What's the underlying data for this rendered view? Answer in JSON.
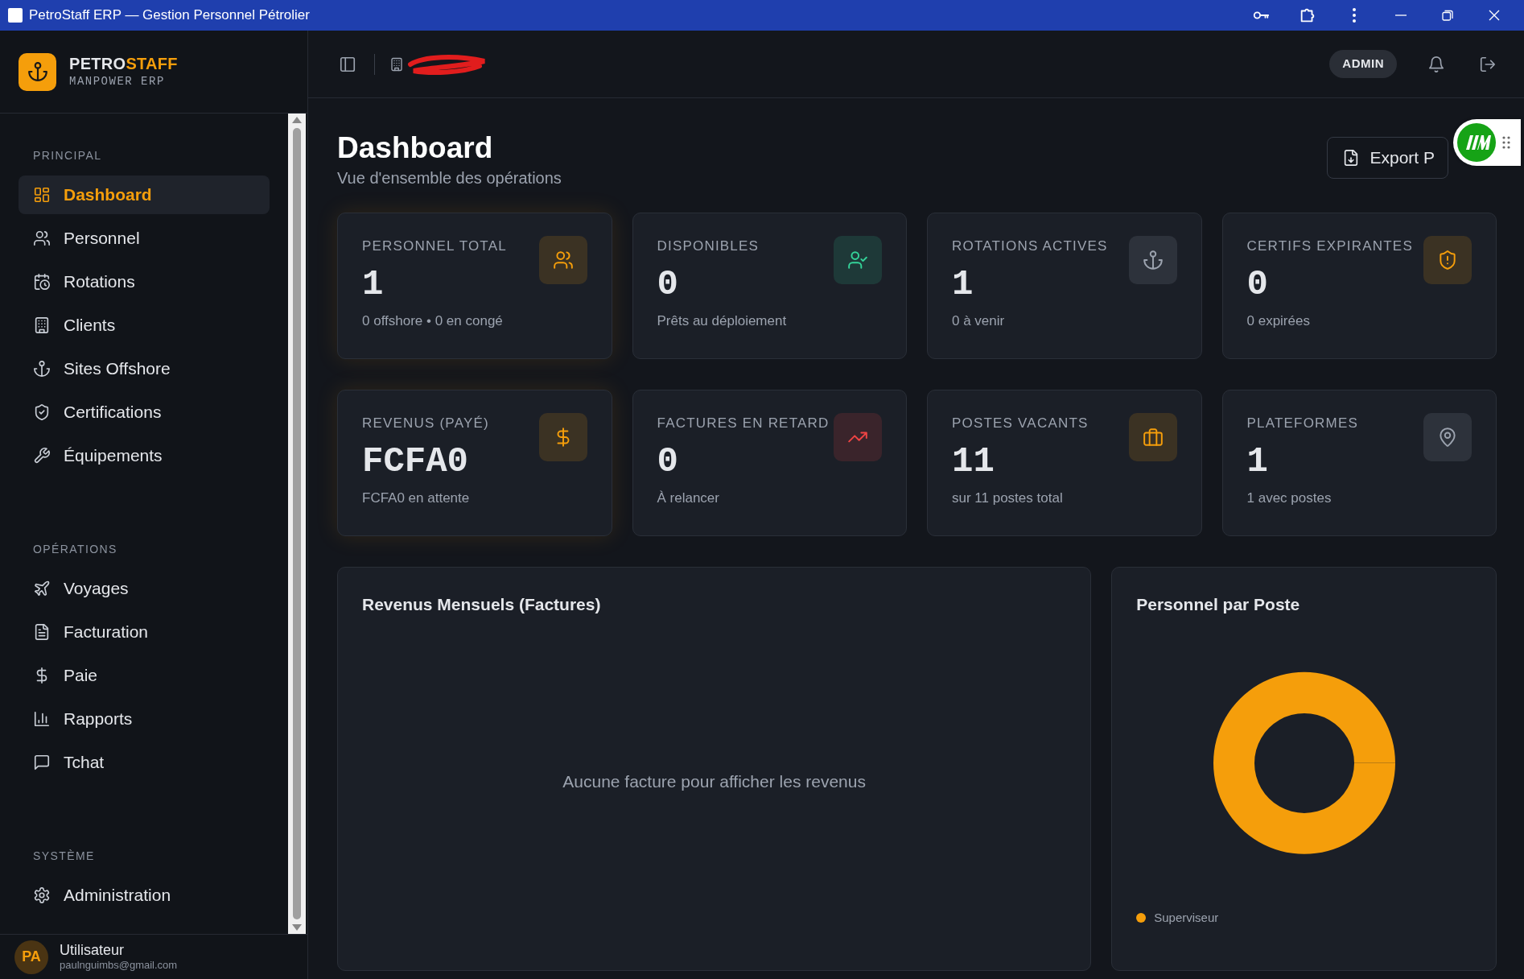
{
  "window": {
    "title": "PetroStaff ERP — Gestion Personnel Pétrolier"
  },
  "brand": {
    "name_first": "PETRO",
    "name_second": "STAFF",
    "subtitle": "MANPOWER ERP"
  },
  "sidebar": {
    "sections": [
      {
        "title": "PRINCIPAL",
        "items": [
          {
            "label": "Dashboard",
            "selected": true
          },
          {
            "label": "Personnel",
            "selected": false
          },
          {
            "label": "Rotations",
            "selected": false
          },
          {
            "label": "Clients",
            "selected": false
          },
          {
            "label": "Sites Offshore",
            "selected": false
          },
          {
            "label": "Certifications",
            "selected": false
          },
          {
            "label": "Équipements",
            "selected": false
          }
        ]
      },
      {
        "title": "OPÉRATIONS",
        "items": [
          {
            "label": "Voyages",
            "selected": false
          },
          {
            "label": "Facturation",
            "selected": false
          },
          {
            "label": "Paie",
            "selected": false
          },
          {
            "label": "Rapports",
            "selected": false
          },
          {
            "label": "Tchat",
            "selected": false
          }
        ]
      },
      {
        "title": "SYSTÈME",
        "items": [
          {
            "label": "Administration",
            "selected": false
          }
        ]
      }
    ]
  },
  "user": {
    "initials": "PA",
    "name": "Utilisateur",
    "email": "paulnguimbs@gmail.com"
  },
  "header": {
    "role_badge": "ADMIN"
  },
  "page": {
    "title": "Dashboard",
    "subtitle": "Vue d'ensemble des opérations",
    "export_button": "Export P"
  },
  "stats": [
    {
      "label": "PERSONNEL TOTAL",
      "value": "1",
      "detail": "0 offshore • 0 en congé",
      "color": "#f59e0b",
      "glow": true
    },
    {
      "label": "DISPONIBLES",
      "value": "0",
      "detail": "Prêts au déploiement",
      "color": "#34d399",
      "glow": false
    },
    {
      "label": "ROTATIONS ACTIVES",
      "value": "1",
      "detail": "0 à venir",
      "color": "#9ca3af",
      "glow": false
    },
    {
      "label": "CERTIFS EXPIRANTES",
      "value": "0",
      "detail": "0 expirées",
      "color": "#f59e0b",
      "glow": false
    },
    {
      "label": "REVENUS (PAYÉ)",
      "value": "FCFA0",
      "detail": "FCFA0 en attente",
      "color": "#f59e0b",
      "glow": true
    },
    {
      "label": "FACTURES EN RETARD",
      "value": "0",
      "detail": "À relancer",
      "color": "#ef4444",
      "glow": false
    },
    {
      "label": "POSTES VACANTS",
      "value": "11",
      "detail": "sur 11 postes total",
      "color": "#f59e0b",
      "glow": false
    },
    {
      "label": "PLATEFORMES",
      "value": "1",
      "detail": "1 avec postes",
      "color": "#9ca3af",
      "glow": false
    }
  ],
  "revenue_panel": {
    "title": "Revenus Mensuels (Factures)",
    "empty_message": "Aucune facture pour afficher les revenus"
  },
  "position_panel": {
    "title": "Personnel par Poste",
    "legend": [
      {
        "label": "Superviseur",
        "color": "#f59e0b"
      }
    ]
  }
}
